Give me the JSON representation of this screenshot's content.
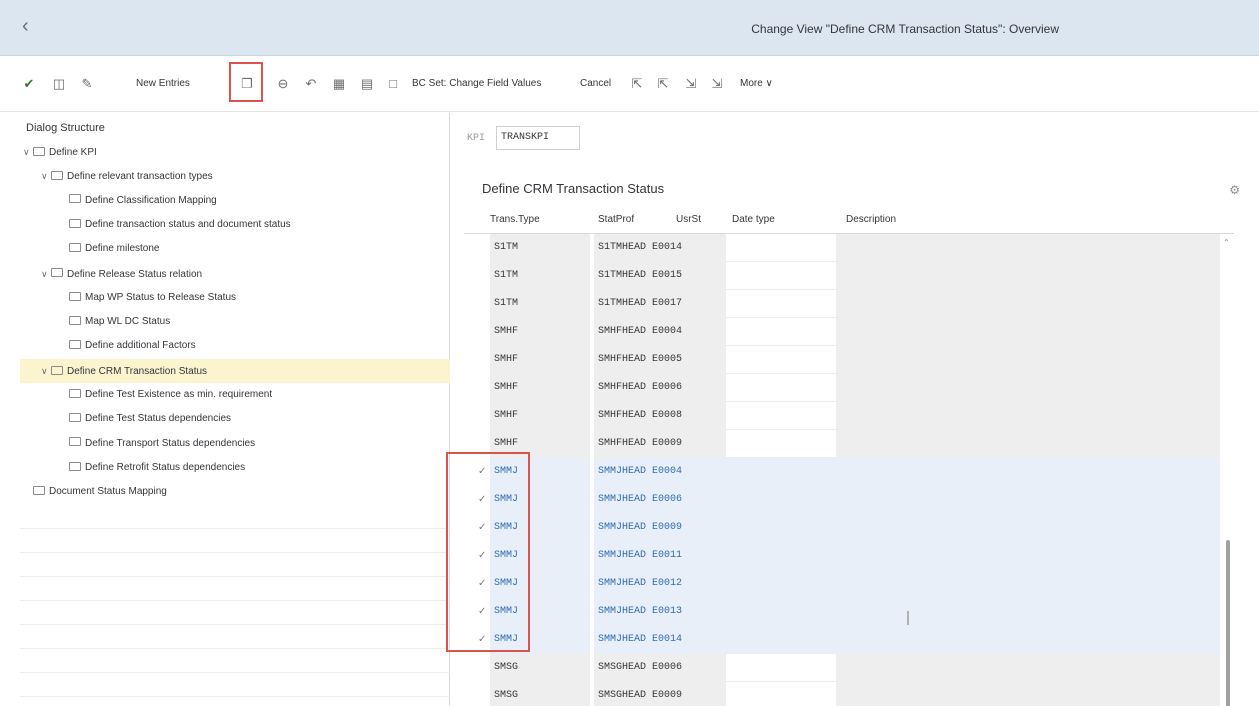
{
  "window": {
    "title": "Change View \"Define CRM Transaction Status\": Overview",
    "back_icon": "chevron-left-icon"
  },
  "toolbar": {
    "new_entries": "New Entries",
    "bc_set": "BC Set: Change Field Values",
    "cancel": "Cancel",
    "more": "More ∨"
  },
  "left": {
    "header": "Dialog Structure",
    "tree": [
      {
        "label": "Define KPI",
        "level": 0,
        "expanded": true
      },
      {
        "label": "Define relevant transaction types",
        "level": 1,
        "expanded": true
      },
      {
        "label": "Define Classification Mapping",
        "level": 2
      },
      {
        "label": "Define transaction status and document status",
        "level": 2
      },
      {
        "label": "Define milestone",
        "level": 2
      },
      {
        "label": "Define Release Status relation",
        "level": 1,
        "expanded": true
      },
      {
        "label": "Map WP Status to Release Status",
        "level": 2
      },
      {
        "label": "Map WL DC Status",
        "level": 2
      },
      {
        "label": "Define additional Factors",
        "level": 2
      },
      {
        "label": "Define CRM Transaction Status",
        "level": 1,
        "expanded": true,
        "selected": true
      },
      {
        "label": "Define Test Existence as min. requirement",
        "level": 2
      },
      {
        "label": "Define Test Status dependencies",
        "level": 2
      },
      {
        "label": "Define Transport Status dependencies",
        "level": 2
      },
      {
        "label": "Define Retrofit Status dependencies",
        "level": 2
      },
      {
        "label": "Document Status Mapping",
        "level": 0
      }
    ]
  },
  "right": {
    "kpi_label": "KPI",
    "kpi_value": "TRANSKPI",
    "table_title": "Define CRM Transaction Status",
    "columns": [
      "Trans.Type",
      "StatProf",
      "UsrSt",
      "Date type",
      "Description"
    ],
    "rows": [
      {
        "trans": "S1TM",
        "prof": "S1TMHEAD",
        "usr": "E0014",
        "sel": false
      },
      {
        "trans": "S1TM",
        "prof": "S1TMHEAD",
        "usr": "E0015",
        "sel": false
      },
      {
        "trans": "S1TM",
        "prof": "S1TMHEAD",
        "usr": "E0017",
        "sel": false
      },
      {
        "trans": "SMHF",
        "prof": "SMHFHEAD",
        "usr": "E0004",
        "sel": false
      },
      {
        "trans": "SMHF",
        "prof": "SMHFHEAD",
        "usr": "E0005",
        "sel": false
      },
      {
        "trans": "SMHF",
        "prof": "SMHFHEAD",
        "usr": "E0006",
        "sel": false
      },
      {
        "trans": "SMHF",
        "prof": "SMHFHEAD",
        "usr": "E0008",
        "sel": false
      },
      {
        "trans": "SMHF",
        "prof": "SMHFHEAD",
        "usr": "E0009",
        "sel": false
      },
      {
        "trans": "SMMJ",
        "prof": "SMMJHEAD",
        "usr": "E0004",
        "sel": true
      },
      {
        "trans": "SMMJ",
        "prof": "SMMJHEAD",
        "usr": "E0006",
        "sel": true
      },
      {
        "trans": "SMMJ",
        "prof": "SMMJHEAD",
        "usr": "E0009",
        "sel": true
      },
      {
        "trans": "SMMJ",
        "prof": "SMMJHEAD",
        "usr": "E0011",
        "sel": true
      },
      {
        "trans": "SMMJ",
        "prof": "SMMJHEAD",
        "usr": "E0012",
        "sel": true
      },
      {
        "trans": "SMMJ",
        "prof": "SMMJHEAD",
        "usr": "E0013",
        "sel": true
      },
      {
        "trans": "SMMJ",
        "prof": "SMMJHEAD",
        "usr": "E0014",
        "sel": true
      },
      {
        "trans": "SMSG",
        "prof": "SMSGHEAD",
        "usr": "E0006",
        "sel": false
      },
      {
        "trans": "SMSG",
        "prof": "SMSGHEAD",
        "usr": "E0009",
        "sel": false
      }
    ]
  },
  "colors": {
    "title_bar": "#dbe6f1",
    "selection_blue": "#2f6cb3",
    "highlight_yellow": "#fcf3cf",
    "red_outline": "#d9534f"
  }
}
